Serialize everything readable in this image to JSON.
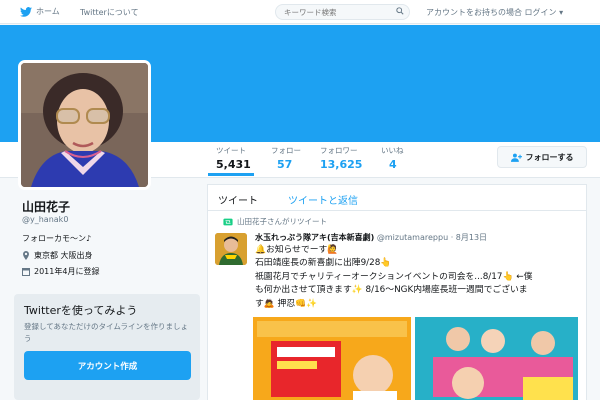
{
  "nav": {
    "home_label": "ホーム",
    "about_label": "Twitterについて",
    "search_placeholder": "キーワード検索",
    "login_text": "アカウントをお持ちの場合 ログイン ▾"
  },
  "profile": {
    "name": "山田花子",
    "handle": "@y_hanak0",
    "bio": "フォローカモ〜ン♪",
    "location": "東京都 大阪出身",
    "joined": "2011年4月に登録"
  },
  "stats": [
    {
      "label": "ツイート",
      "value": "5,431"
    },
    {
      "label": "フォロー",
      "value": "57"
    },
    {
      "label": "フォロワー",
      "value": "13,625"
    },
    {
      "label": "いいね",
      "value": "4"
    }
  ],
  "follow_button": "フォローする",
  "signup": {
    "title": "Twitterを使ってみよう",
    "description": "登録してあなただけのタイムラインを作りましょう",
    "button": "アカウント作成"
  },
  "tabs": [
    "ツイート",
    "ツイートと返信"
  ],
  "tweet": {
    "retweet_text": "山田花子さんがリツイート",
    "author_name": "水玉れっぷう隊アキ(吉本新喜劇)",
    "author_handle": "@mizutamareppu",
    "date": "8月13日",
    "lines": [
      "🔔お知らせでーす🙋",
      "石田靖座長の新喜劇に出陣9/28👆",
      "祇園花月でチャリティーオークションイベントの司会を...8/17👆 ←僕",
      "も何か出させて頂きます✨ 8/16〜NGK内場座長班一週間でございま",
      "す🙇 押忍👊✨"
    ]
  },
  "colors": {
    "brand": "#1da1f2",
    "text": "#14171a",
    "muted": "#657786"
  }
}
